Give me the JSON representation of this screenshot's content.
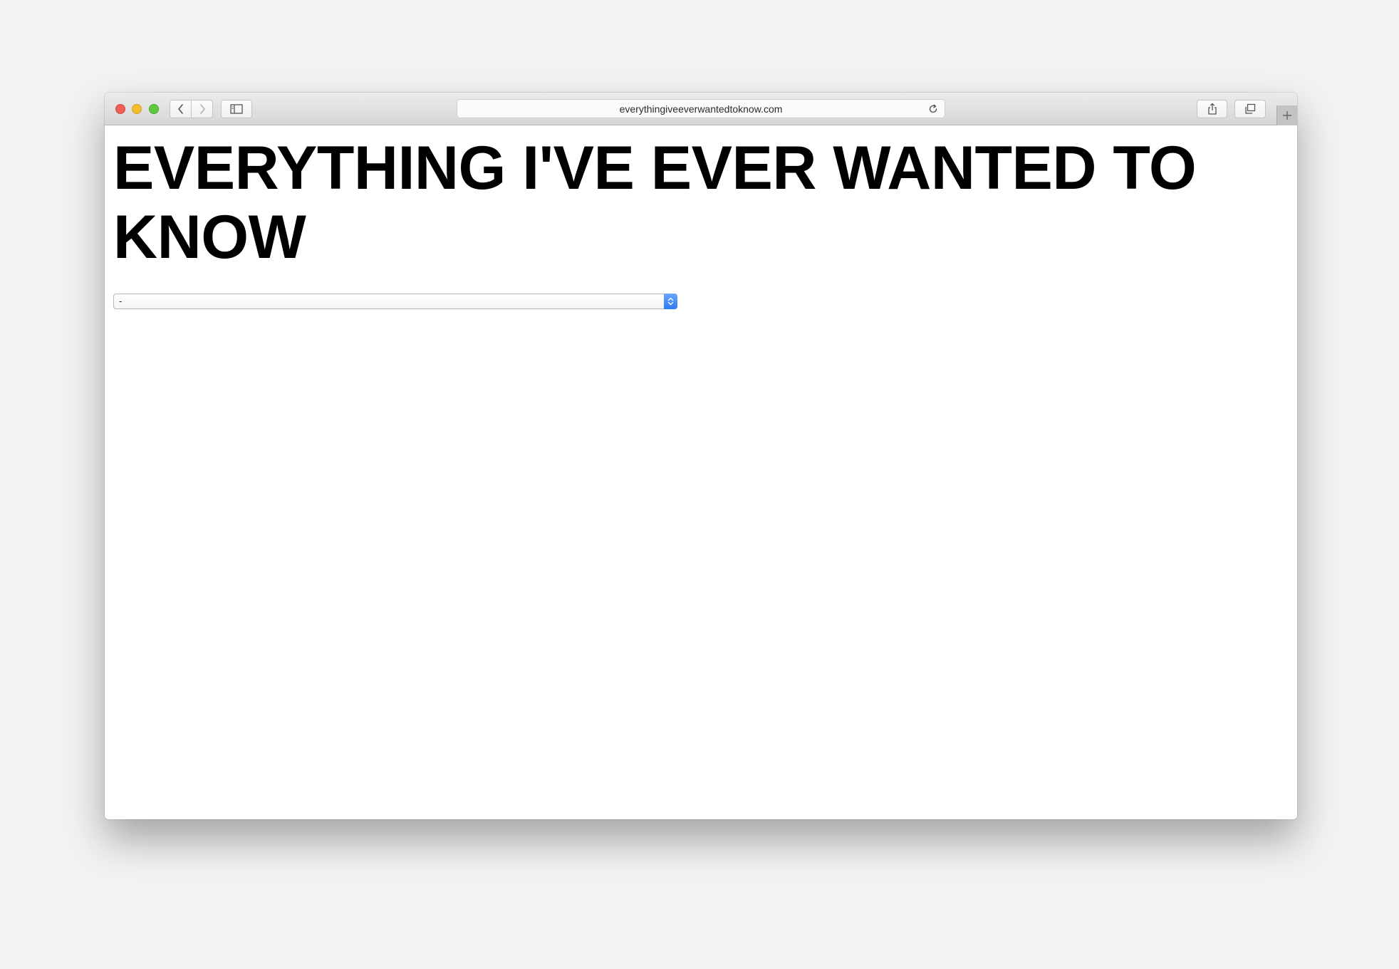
{
  "browser": {
    "address_bar": {
      "url": "everythingiveeverwantedtoknow.com"
    },
    "icons": {
      "back": "chevron-left-icon",
      "forward": "chevron-right-icon",
      "sidebar": "sidebar-icon",
      "reload": "reload-icon",
      "share": "share-icon",
      "tabs": "tabs-overview-icon",
      "new_tab": "plus-icon"
    },
    "colors": {
      "close": "#ee5f55",
      "minimize": "#f5be31",
      "zoom": "#5fc83f"
    }
  },
  "page": {
    "title": "EVERYTHING I'VE EVER WANTED TO KNOW",
    "select": {
      "selected_value": "-",
      "accent": "#2f7bf0"
    }
  }
}
